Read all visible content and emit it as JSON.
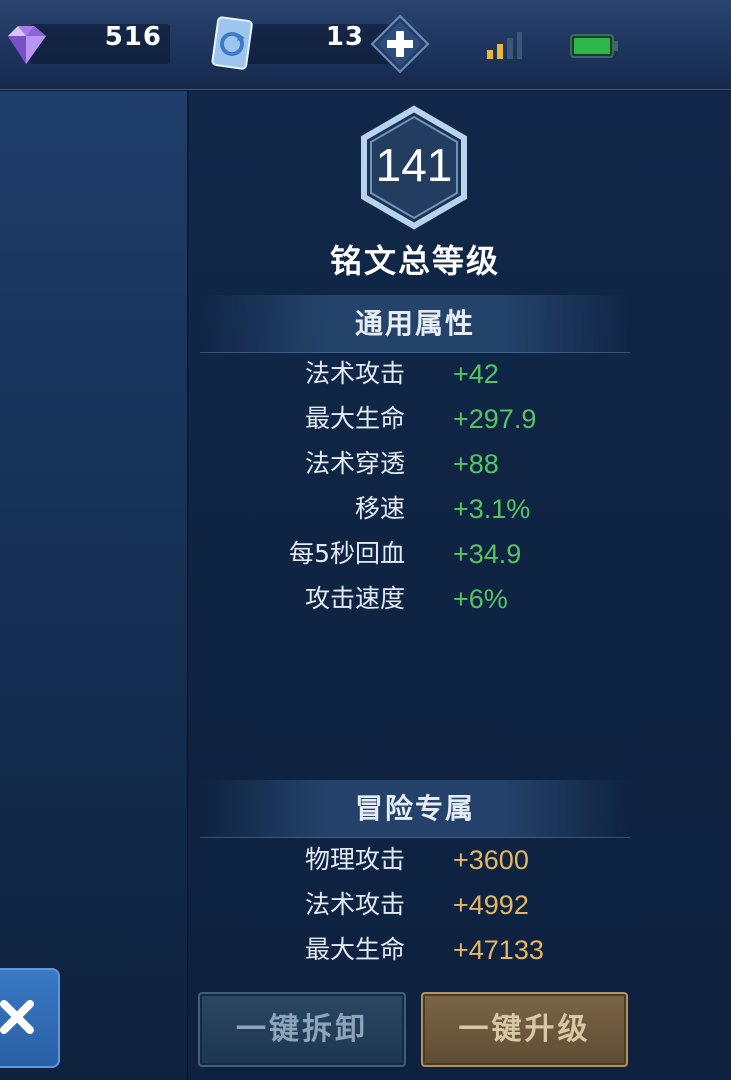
{
  "topbar": {
    "diamonds": "516",
    "cards": "13",
    "icons": {
      "diamond": "purple-gem-icon",
      "card": "card-refresh-icon",
      "add": "plus-icon",
      "signal": "signal-icon",
      "battery": "battery-icon"
    }
  },
  "rune": {
    "level": "141",
    "title": "铭文总等级"
  },
  "general": {
    "header": "通用属性",
    "stats": [
      {
        "label": "法术攻击",
        "value": "+42"
      },
      {
        "label": "最大生命",
        "value": "+297.9"
      },
      {
        "label": "法术穿透",
        "value": "+88"
      },
      {
        "label": "移速",
        "value": "+3.1%"
      },
      {
        "label": "每5秒回血",
        "value": "+34.9"
      },
      {
        "label": "攻击速度",
        "value": "+6%"
      }
    ]
  },
  "adventure": {
    "header": "冒险专属",
    "stats": [
      {
        "label": "物理攻击",
        "value": "+3600"
      },
      {
        "label": "法术攻击",
        "value": "+4992"
      },
      {
        "label": "最大生命",
        "value": "+47133"
      }
    ]
  },
  "buttons": {
    "dismantle": "一键拆卸",
    "upgrade": "一键升级"
  },
  "colors": {
    "general_value": "#58c460",
    "adventure_value": "#e3b663"
  }
}
